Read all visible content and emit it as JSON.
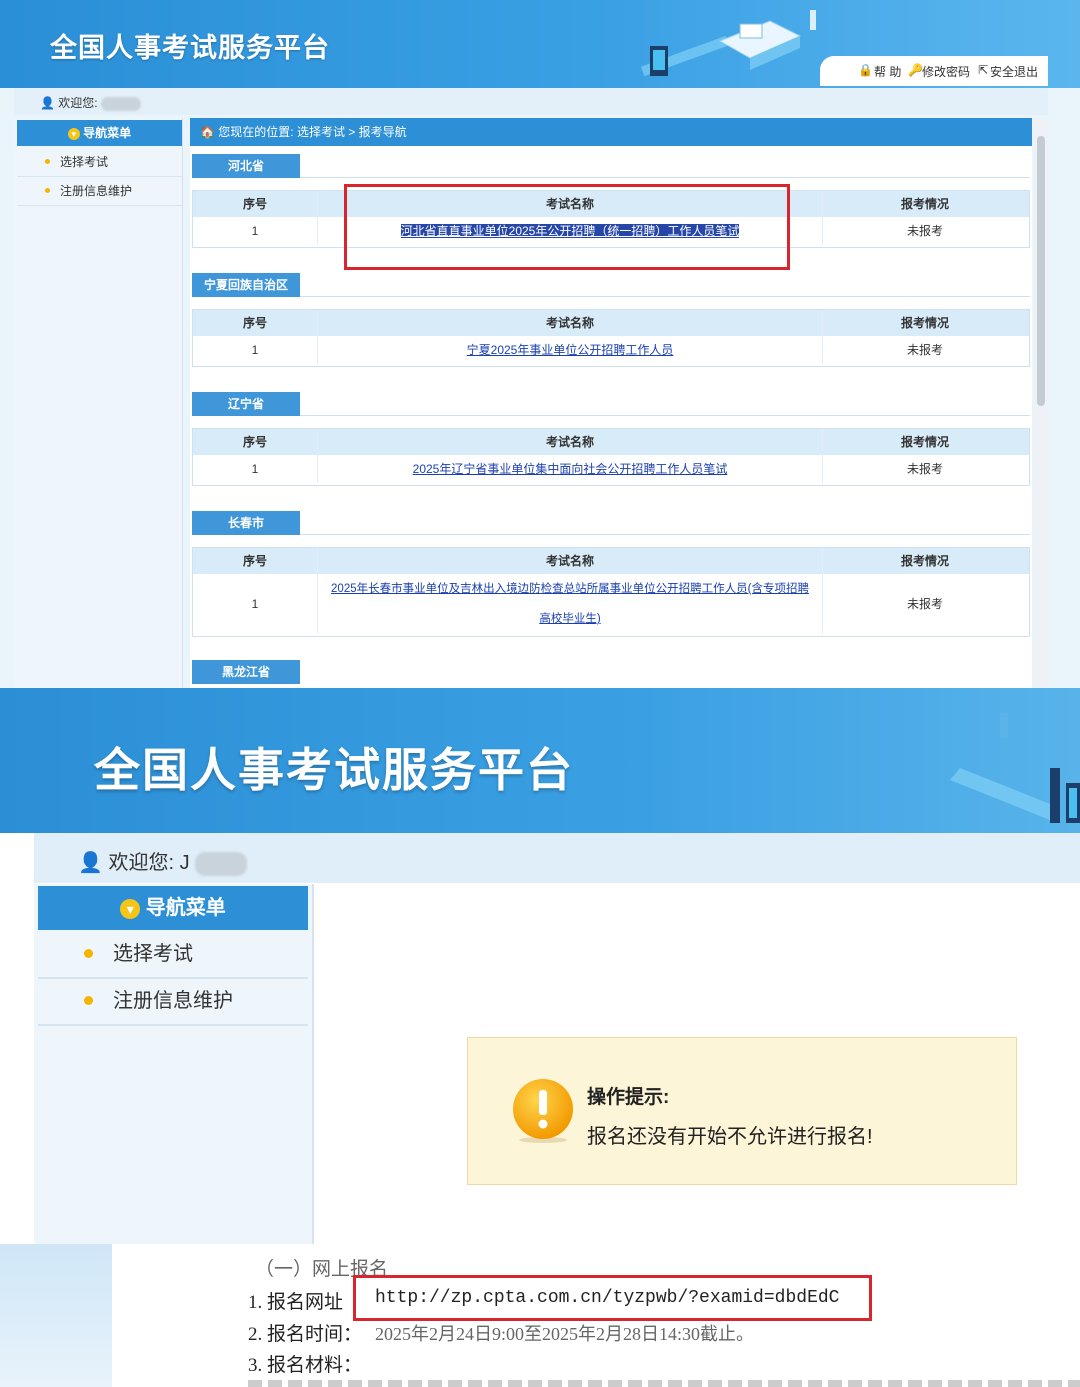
{
  "top_screen": {
    "header": {
      "title": "全国人事考试服务平台",
      "links": {
        "help": "帮 助",
        "change_password": "修改密码",
        "logout": "安全退出"
      }
    },
    "welcome_label": "欢迎您:",
    "sidebar": {
      "menu_title": "导航菜单",
      "items": [
        {
          "label": "选择考试"
        },
        {
          "label": "注册信息维护"
        }
      ]
    },
    "breadcrumb": "您现在的位置: 选择考试 > 报考导航",
    "columns": {
      "index": "序号",
      "exam_name": "考试名称",
      "status": "报考情况"
    },
    "regions": [
      {
        "name": "河北省",
        "exams": [
          {
            "index": "1",
            "name": "河北省直直事业单位2025年公开招聘（统一招聘）工作人员笔试",
            "status": "未报考"
          }
        ]
      },
      {
        "name": "宁夏回族自治区",
        "exams": [
          {
            "index": "1",
            "name": "宁夏2025年事业单位公开招聘工作人员",
            "status": "未报考"
          }
        ]
      },
      {
        "name": "辽宁省",
        "exams": [
          {
            "index": "1",
            "name": "2025年辽宁省事业单位集中面向社会公开招聘工作人员笔试",
            "status": "未报考"
          }
        ]
      },
      {
        "name": "长春市",
        "exams": [
          {
            "index": "1",
            "name": "2025年长春市事业单位及吉林出入境边防检查总站所属事业单位公开招聘工作人员(含专项招聘",
            "name_line2": "高校毕业生)",
            "status": "未报考"
          }
        ]
      },
      {
        "name": "黑龙江省",
        "exams": []
      }
    ]
  },
  "middle_screen": {
    "header": {
      "title": "全国人事考试服务平台"
    },
    "welcome_label": "欢迎您:",
    "welcome_fragment": "J",
    "sidebar": {
      "menu_title": "导航菜单",
      "items": [
        {
          "label": "选择考试"
        },
        {
          "label": "注册信息维护"
        }
      ]
    },
    "notice": {
      "title": "操作提示:",
      "message": "报名还没有开始不允许进行报名!"
    }
  },
  "document": {
    "section": "（一）网上报名",
    "line1_label": "1. 报名网址",
    "url": "http://zp.cpta.com.cn/tyzpwb/?examid=dbdEdC",
    "line2_label": "2. 报名时间：",
    "line2_value": "2025年2月24日9:00至2025年2月28日14:30截止。",
    "line3_label": "3. 报名材料："
  },
  "colors": {
    "header_blue": "#2d8fd5",
    "highlight_red": "#d7262d",
    "link_blue": "#1a3fb0",
    "notice_bg": "#fdf5d8",
    "warning_orange": "#f5a300"
  }
}
